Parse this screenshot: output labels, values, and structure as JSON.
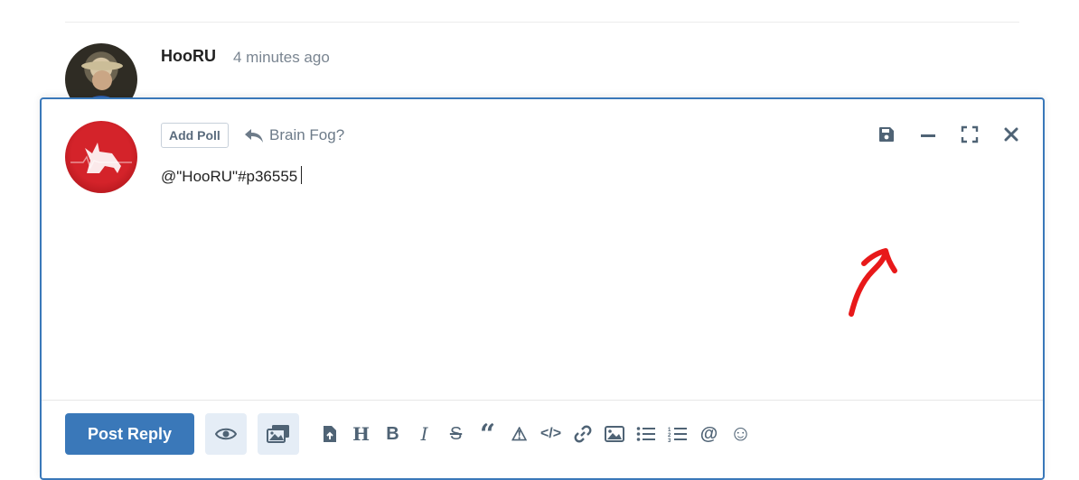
{
  "post": {
    "author": "HooRU",
    "time": "4 minutes ago"
  },
  "composer": {
    "add_poll_label": "Add Poll",
    "reply_context_title": "Brain Fog?",
    "editor_text": "@\"HooRU\"#p36555",
    "controls": {
      "save_icon": "save-icon",
      "minimize_icon": "minimize-icon",
      "fullscreen_icon": "fullscreen-icon",
      "close_icon": "close-icon"
    },
    "annotation_color": "#e8191a"
  },
  "toolbar": {
    "post_label": "Post Reply",
    "preview_icon": "eye-icon",
    "image_toggle_icon": "images-icon",
    "tools": [
      {
        "name": "upload-file",
        "glyph": "⤒"
      },
      {
        "name": "heading",
        "glyph": "H"
      },
      {
        "name": "bold",
        "glyph": "B"
      },
      {
        "name": "italic",
        "glyph": "I"
      },
      {
        "name": "strikethrough",
        "glyph": "S"
      },
      {
        "name": "quote",
        "glyph": "“"
      },
      {
        "name": "spoiler",
        "glyph": "⚠"
      },
      {
        "name": "code",
        "glyph": "</>"
      },
      {
        "name": "link",
        "glyph": "🔗"
      },
      {
        "name": "image",
        "glyph": "🖼"
      },
      {
        "name": "bullet-list",
        "glyph": "≡"
      },
      {
        "name": "numbered-list",
        "glyph": "≡"
      },
      {
        "name": "mention",
        "glyph": "@"
      },
      {
        "name": "emoji",
        "glyph": "☺"
      }
    ]
  },
  "colors": {
    "accent": "#3a78b9",
    "muted_text": "#7a8591",
    "icon": "#4f6375"
  }
}
